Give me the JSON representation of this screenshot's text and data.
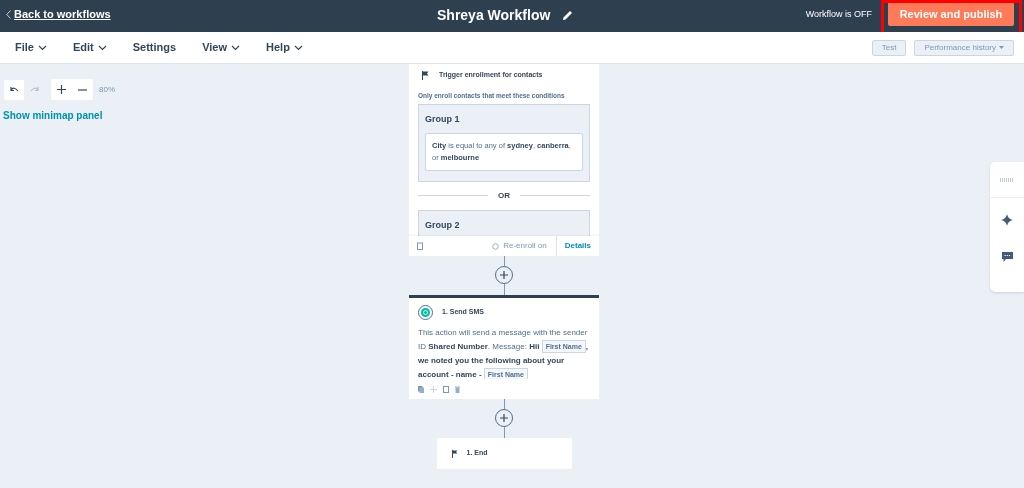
{
  "top_bar": {
    "back_link": "Back to workflows",
    "title": "Shreya Workflow",
    "status": "Workflow is OFF",
    "publish_button": "Review and publish",
    "highlighted": true
  },
  "menu": [
    {
      "label": "File",
      "dropdown": true
    },
    {
      "label": "Edit",
      "dropdown": true
    },
    {
      "label": "Settings",
      "dropdown": false
    },
    {
      "label": "View",
      "dropdown": true
    },
    {
      "label": "Help",
      "dropdown": true
    }
  ],
  "toolbar_buttons": [
    {
      "label": "Test",
      "dropdown": false
    },
    {
      "label": "Performance history",
      "dropdown": true
    }
  ],
  "canvas_controls": {
    "undo_enabled": true,
    "redo_enabled": false,
    "zoom": "80%",
    "minimap_link": "Show minimap panel"
  },
  "trigger": {
    "title": "Trigger enrollment for contacts",
    "subtitle": "Only enroll contacts that meet these conditions",
    "groups": [
      {
        "name": "Group 1",
        "condition": "**City** is equal to any of **sydney**, **canberra**, or **melbourne**"
      },
      {
        "name": "Group 2"
      }
    ],
    "separator": "OR",
    "reenroll": "Re-enroll on",
    "details": "Details"
  },
  "actions": [
    {
      "kind": "sms",
      "title": "1. Send SMS",
      "message": [
        {
          "kind": "text",
          "text": "This action will send a message with the sender ID **Shared Number**. Message: **Hii**"
        },
        {
          "kind": "token",
          "text": "First Name"
        },
        {
          "kind": "text",
          "text": "**, we noted you the following about your account - name -**"
        },
        {
          "kind": "token",
          "text": "First Name"
        }
      ]
    },
    {
      "kind": "end",
      "title": "1. End"
    }
  ]
}
